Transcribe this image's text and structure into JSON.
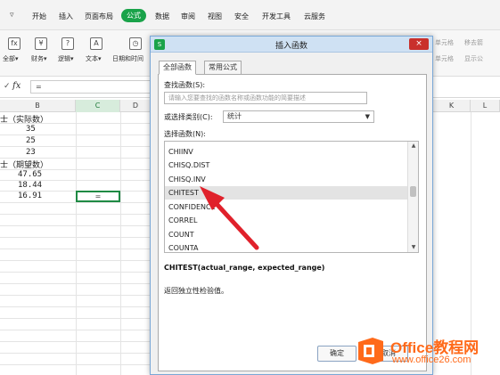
{
  "menubar": {
    "items": [
      "开始",
      "插入",
      "页面布局",
      "公式",
      "数据",
      "审阅",
      "视图",
      "安全",
      "开发工具",
      "云服务"
    ],
    "active_index": 3
  },
  "ribbon": {
    "groups": [
      "全部▾",
      "财务▾",
      "逻辑▾",
      "文本▾",
      "日期和时间"
    ],
    "right1": "单元格",
    "right2": "移去箭",
    "right3": "单元格",
    "right4": "显示公"
  },
  "formula_bar": {
    "fx_label": "fx",
    "value": "="
  },
  "columns": {
    "B": "B",
    "C": "C",
    "D": "D",
    "K": "K",
    "L": "L"
  },
  "sheet": {
    "header_actual": "士（实际数）",
    "actual_values": [
      "35",
      "25",
      "23"
    ],
    "header_expected": "士（期望数）",
    "expected_values": [
      "47.65",
      "18.44",
      "16.91"
    ],
    "active_cell_value": "="
  },
  "dialog": {
    "title": "插入函数",
    "close_label": "×",
    "logo": "S",
    "tabs": [
      "全部函数",
      "常用公式"
    ],
    "search_label": "查找函数(S):",
    "search_placeholder": "请输入您要查找的函数名称或函数功能的简要描述",
    "category_label": "或选择类别(C):",
    "category_value": "统计",
    "list_label": "选择函数(N):",
    "functions": [
      "CHIINV",
      "CHISQ.DIST",
      "CHISQ.INV",
      "CHITEST",
      "CONFIDENCE",
      "CORREL",
      "COUNT",
      "COUNTA"
    ],
    "selected_index": 3,
    "signature": "CHITEST(actual_range, expected_range)",
    "description": "返回独立性检验值。",
    "ok_label": "确定",
    "cancel_label": "取消"
  },
  "watermark": {
    "brand": "Office教程网",
    "url": "www.office26.com"
  },
  "colors": {
    "accent_green": "#1aa34a",
    "arrow_red": "#e0212b",
    "watermark_orange": "#ff6a1a"
  }
}
